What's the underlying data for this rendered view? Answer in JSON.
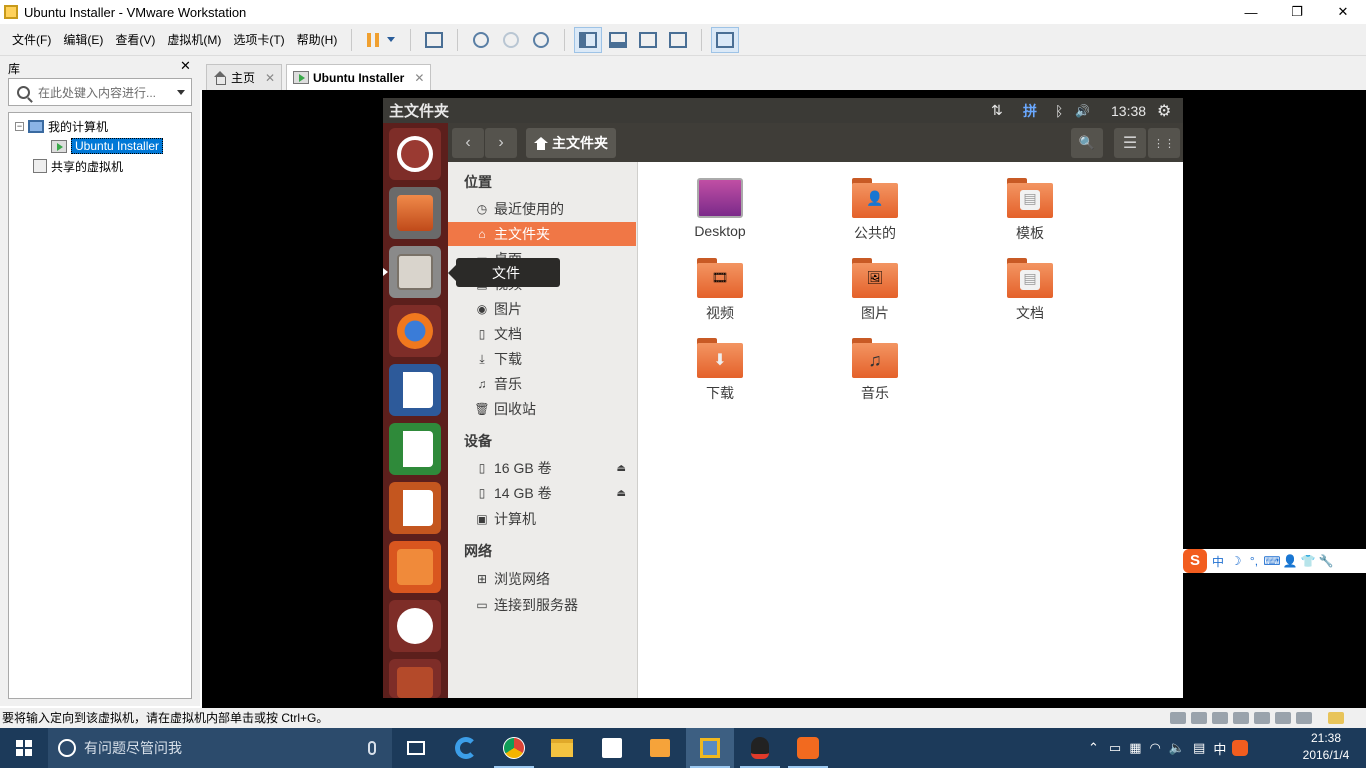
{
  "window": {
    "title": "Ubuntu Installer - VMware Workstation",
    "minimize": "—",
    "maximize": "❐",
    "close": "✕"
  },
  "menu": [
    "文件(F)",
    "编辑(E)",
    "查看(V)",
    "虚拟机(M)",
    "选项卡(T)",
    "帮助(H)"
  ],
  "library": {
    "title": "库",
    "close": "✕",
    "search_placeholder": "在此处键入内容进行...",
    "tree": {
      "my_computer": "我的计算机",
      "vm": "Ubuntu Installer",
      "shared": "共享的虚拟机",
      "expand_glyph": "−"
    }
  },
  "tabs": [
    {
      "label": "主页",
      "close": "✕"
    },
    {
      "label": "Ubuntu Installer",
      "close": "✕"
    }
  ],
  "ubuntu": {
    "top_title": "主文件夹",
    "indicators": {
      "network": "⇅",
      "input_method": "拼",
      "bluetooth": "ᛒ",
      "volume": "🔊",
      "time": "13:38",
      "settings": "⚙"
    },
    "nav": {
      "back": "‹",
      "forward": "›",
      "path": "主文件夹",
      "search": "🔍",
      "list": "☰",
      "grid": "⋮⋮"
    },
    "tooltip": "文件",
    "sidebar": {
      "places_header": "位置",
      "places": [
        {
          "label": "最近使用的",
          "icon": "◷"
        },
        {
          "label": "主文件夹",
          "icon": "⌂"
        },
        {
          "label": "桌面",
          "icon": "▭"
        },
        {
          "label": "视频",
          "icon": "▤"
        },
        {
          "label": "图片",
          "icon": "◉"
        },
        {
          "label": "文档",
          "icon": "▯"
        },
        {
          "label": "下载",
          "icon": "⤓"
        },
        {
          "label": "音乐",
          "icon": "♫"
        },
        {
          "label": "回收站",
          "icon": "🗑"
        }
      ],
      "devices_header": "设备",
      "devices": [
        {
          "label": "16 GB 卷",
          "icon": "▯",
          "eject": "⏏"
        },
        {
          "label": "14 GB 卷",
          "icon": "▯",
          "eject": "⏏"
        },
        {
          "label": "计算机",
          "icon": "▣"
        }
      ],
      "network_header": "网络",
      "network": [
        {
          "label": "浏览网络",
          "icon": "⊞"
        },
        {
          "label": "连接到服务器",
          "icon": "▭"
        }
      ]
    },
    "files": [
      {
        "label": "Desktop",
        "emblem": ""
      },
      {
        "label": "公共的",
        "emblem": "👤"
      },
      {
        "label": "模板",
        "emblem": "▤"
      },
      {
        "label": "视频",
        "emblem": "🎞"
      },
      {
        "label": "图片",
        "emblem": "🖼"
      },
      {
        "label": "文档",
        "emblem": "▤"
      },
      {
        "label": "下载",
        "emblem": "⬇"
      },
      {
        "label": "音乐",
        "emblem": "♫"
      }
    ]
  },
  "sogou": {
    "logo": "S",
    "items": [
      "中",
      "☽",
      "°,",
      "⌨",
      "👤",
      "👕",
      "🔧"
    ]
  },
  "status_text": "要将输入定向到该虚拟机，请在虚拟机内部单击或按 Ctrl+G。",
  "taskbar": {
    "search_placeholder": "有问题尽管问我",
    "tray_lang": "中",
    "time": "21:38",
    "date": "2016/1/4"
  },
  "colors": {
    "accent_orange": "#f07746",
    "launcher": "#5c1f1c",
    "vmware_select": "#0078d7",
    "taskbar": "#1c3a5a"
  }
}
